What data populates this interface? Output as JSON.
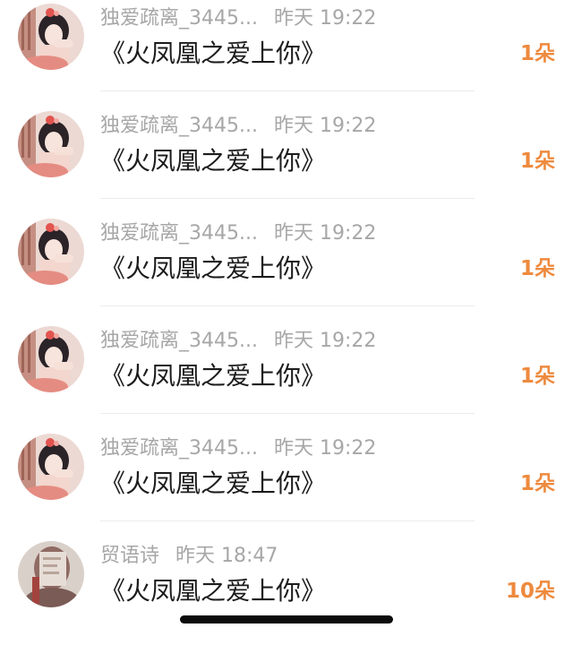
{
  "gifts": [
    {
      "user": "独爱疏离_3445...",
      "time": "昨天 19:22",
      "title": "《火凤凰之爱上你》",
      "count": "1朵",
      "avatar": "girl-avatar"
    },
    {
      "user": "独爱疏离_3445...",
      "time": "昨天 19:22",
      "title": "《火凤凰之爱上你》",
      "count": "1朵",
      "avatar": "girl-avatar"
    },
    {
      "user": "独爱疏离_3445...",
      "time": "昨天 19:22",
      "title": "《火凤凰之爱上你》",
      "count": "1朵",
      "avatar": "girl-avatar"
    },
    {
      "user": "独爱疏离_3445...",
      "time": "昨天 19:22",
      "title": "《火凤凰之爱上你》",
      "count": "1朵",
      "avatar": "girl-avatar"
    },
    {
      "user": "独爱疏离_3445...",
      "time": "昨天 19:22",
      "title": "《火凤凰之爱上你》",
      "count": "1朵",
      "avatar": "girl-avatar"
    },
    {
      "user": "贸语诗",
      "time": "昨天 18:47",
      "title": "《火凤凰之爱上你》",
      "count": "10朵",
      "avatar": "sketch-avatar"
    }
  ],
  "colors": {
    "count": "#ee8a3e",
    "meta": "#a7a7a7",
    "title": "#1c1c1c",
    "divider": "#ececec"
  }
}
